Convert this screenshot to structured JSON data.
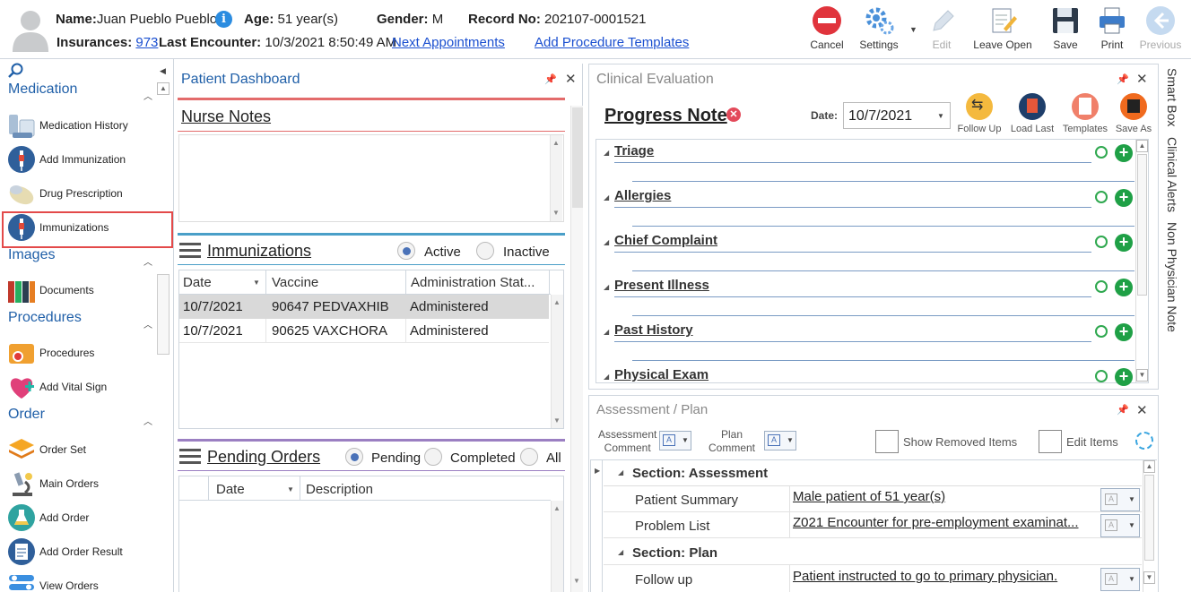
{
  "header": {
    "name_label": "Name:",
    "name_value": "Juan Pueblo Pueblo",
    "age_label": "Age:",
    "age_value": "51 year(s)",
    "gender_label": "Gender:",
    "gender_value": "M",
    "record_label": "Record No:",
    "record_value": "202107-0001521",
    "insurances_label": "Insurances:",
    "insurances_value": "973",
    "last_encounter_label": "Last Encounter:",
    "last_encounter_value": "10/3/2021 8:50:49 AM",
    "next_appointments": "Next Appointments",
    "add_procedure_templates": "Add Procedure Templates"
  },
  "toolbar": {
    "cancel": "Cancel",
    "settings": "Settings",
    "edit": "Edit",
    "leave_open": "Leave Open",
    "save": "Save",
    "print": "Print",
    "previous": "Previous"
  },
  "sidebar": {
    "sections": {
      "medication": "Medication",
      "images": "Images",
      "procedures": "Procedures",
      "order": "Order"
    },
    "items": {
      "medication_history": "Medication History",
      "add_immunization": "Add Immunization",
      "drug_prescription": "Drug Prescription",
      "immunizations": "Immunizations",
      "documents": "Documents",
      "procedures": "Procedures",
      "add_vital_sign": "Add Vital Sign",
      "order_set": "Order Set",
      "main_orders": "Main Orders",
      "add_order": "Add Order",
      "add_order_result": "Add Order Result",
      "view_orders": "View Orders"
    }
  },
  "dashboard": {
    "title": "Patient Dashboard",
    "nurse_notes": "Nurse Notes",
    "immunizations": {
      "title": "Immunizations",
      "radio_active": "Active",
      "radio_inactive": "Inactive",
      "columns": [
        "Date",
        "Vaccine",
        "Administration Stat..."
      ],
      "rows": [
        [
          "10/7/2021",
          "90647 PEDVAXHIB",
          "Administered"
        ],
        [
          "10/7/2021",
          "90625 VAXCHORA",
          "Administered"
        ]
      ]
    },
    "pending_orders": {
      "title": "Pending Orders",
      "radio_pending": "Pending",
      "radio_completed": "Completed",
      "radio_all": "All",
      "columns": [
        "Date",
        "Description"
      ]
    }
  },
  "clinical": {
    "title": "Clinical Evaluation",
    "progress_note": "Progress Note",
    "date_label": "Date:",
    "date_value": "10/7/2021",
    "actions": {
      "follow_up": "Follow Up",
      "load_last": "Load Last",
      "templates": "Templates",
      "save_as": "Save As"
    },
    "sections": [
      "Triage",
      "Allergies",
      "Chief Complaint",
      "Present Illness",
      "Past History",
      "Physical Exam"
    ]
  },
  "assessment": {
    "title": "Assessment / Plan",
    "assessment_comment": [
      "Assessment",
      "Comment"
    ],
    "plan_comment": [
      "Plan",
      "Comment"
    ],
    "show_removed": "Show Removed Items",
    "edit_items": "Edit Items",
    "section_assessment": "Section: Assessment",
    "section_plan": "Section: Plan",
    "rows": {
      "patient_summary_label": "Patient Summary",
      "patient_summary_value": "Male patient of 51 year(s)",
      "problem_list_label": "Problem List",
      "problem_list_value": "Z021 Encounter for pre-employment examinat...",
      "follow_up_label": "Follow up",
      "follow_up_value": "Patient instructed to go to primary physician."
    }
  },
  "right_tabs": {
    "smart_box": "Smart Box",
    "clinical_alerts": "Clinical Alerts",
    "non_physician_note": "Non Physician Note"
  },
  "colors": {
    "accent": "#1f5fa8",
    "highlight": "#e34a4a",
    "nurse_bar": "#e36b6b",
    "immun_bar": "#4a9fc8",
    "pending_bar": "#9b7fc2"
  }
}
